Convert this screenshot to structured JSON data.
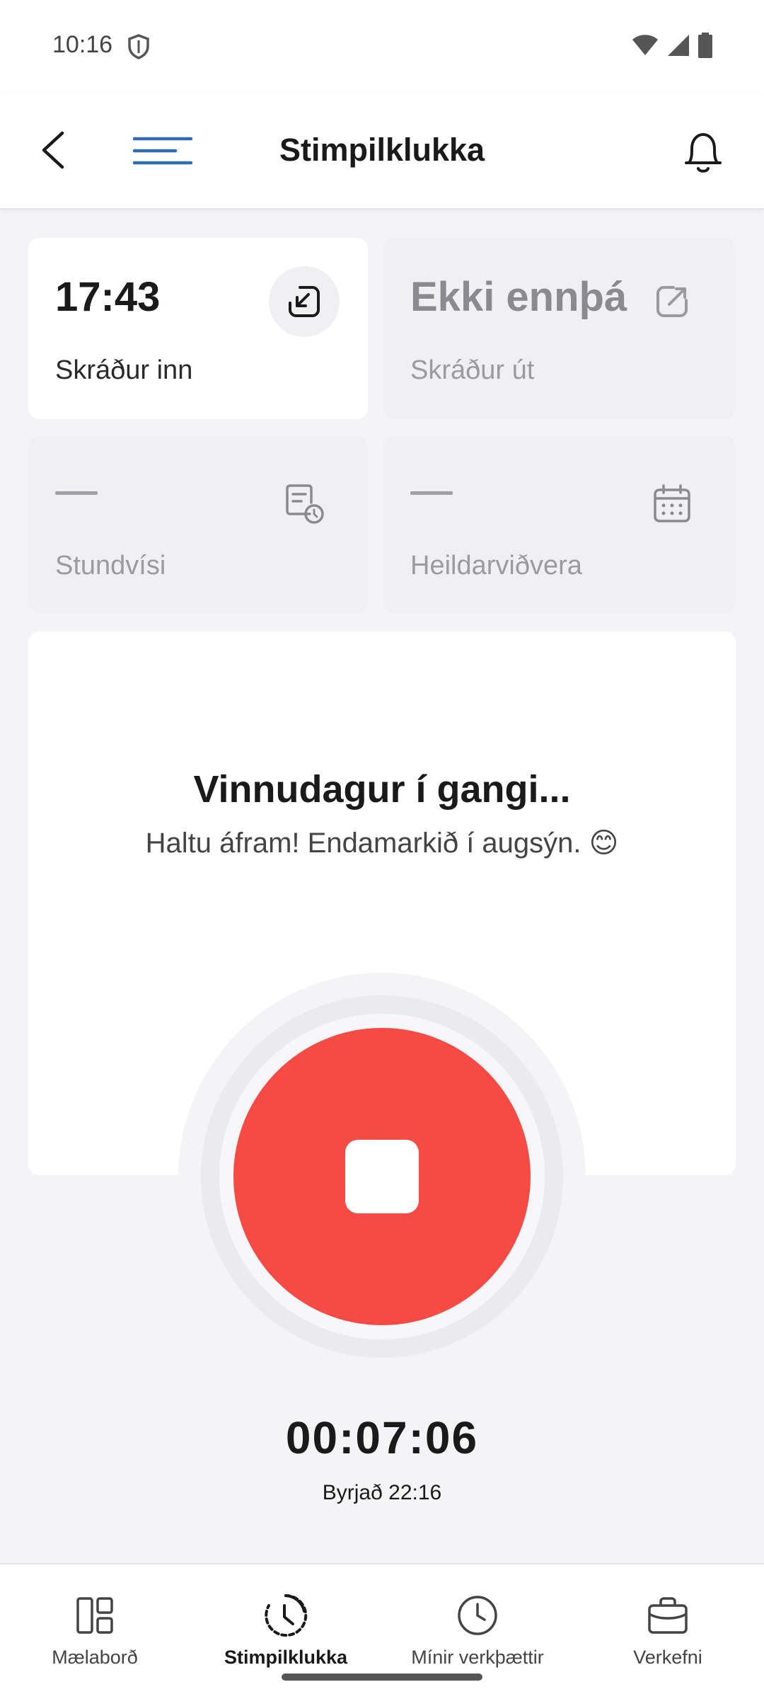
{
  "status_bar": {
    "time": "10:16"
  },
  "app_bar": {
    "title": "Stimpilklukka"
  },
  "cards": {
    "clock_in": {
      "value": "17:43",
      "label": "Skráður inn"
    },
    "clock_out": {
      "value": "Ekki ennþá",
      "label": "Skráður út"
    },
    "punctuality": {
      "value": "—",
      "label": "Stundvísi"
    },
    "total_attendance": {
      "value": "—",
      "label": "Heildarviðvera"
    }
  },
  "panel": {
    "title": "Vinnudagur í gangi...",
    "subtitle": "Haltu áfram! Endamarkið í augsýn. 😊"
  },
  "timer": {
    "elapsed": "00:07:06",
    "started": "Byrjað 22:16"
  },
  "colors": {
    "stop_button": "#f64b45",
    "menu_accent": "#2f6cb5"
  },
  "bottom_nav": {
    "items": [
      {
        "label": "Mælaborð",
        "icon": "dashboard-icon"
      },
      {
        "label": "Stimpilklukka",
        "icon": "timeclock-icon",
        "active": true
      },
      {
        "label": "Mínir verkþættir",
        "icon": "clock-icon"
      },
      {
        "label": "Verkefni",
        "icon": "briefcase-icon"
      }
    ]
  }
}
